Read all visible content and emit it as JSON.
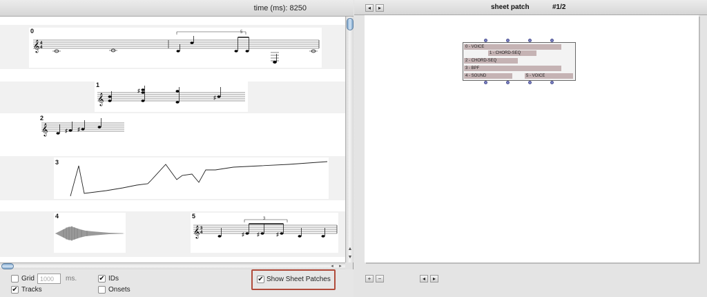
{
  "left_header": {
    "time_label": "time (ms): 8250"
  },
  "tracks": [
    {
      "id": "0",
      "type": "voice",
      "tuplet": "5"
    },
    {
      "id": "1",
      "type": "chord-seq"
    },
    {
      "id": "2",
      "type": "chord-seq"
    },
    {
      "id": "3",
      "type": "bpf"
    },
    {
      "id": "4",
      "type": "sound"
    },
    {
      "id": "5",
      "type": "voice",
      "tuplet": "3"
    }
  ],
  "controls": {
    "grid": {
      "label": "Grid",
      "checked": false,
      "value": "1000",
      "unit": "ms."
    },
    "tracks": {
      "label": "Tracks",
      "checked": true
    },
    "ids": {
      "label": "IDs",
      "checked": true
    },
    "onsets": {
      "label": "Onsets",
      "checked": false
    },
    "show_sheet_patches": {
      "label": "Show Sheet Patches",
      "checked": true
    }
  },
  "right_header": {
    "title": "sheet patch",
    "page": "#1/2"
  },
  "patch": {
    "rows": [
      "0 - VOICE",
      "1 - CHORD-SEQ",
      "2 - CHORD-SEQ",
      "3 - BPF",
      "4 - SOUND",
      "5 - VOICE"
    ]
  },
  "icons": {
    "check": "✔",
    "back": "◂",
    "forward": "▸",
    "plus": "+",
    "minus": "−",
    "up": "▲",
    "down": "▼"
  },
  "colors": {
    "highlight_border": "#b04a3a",
    "patch_row": "#c5b3b4",
    "port": "#7e84c4"
  }
}
